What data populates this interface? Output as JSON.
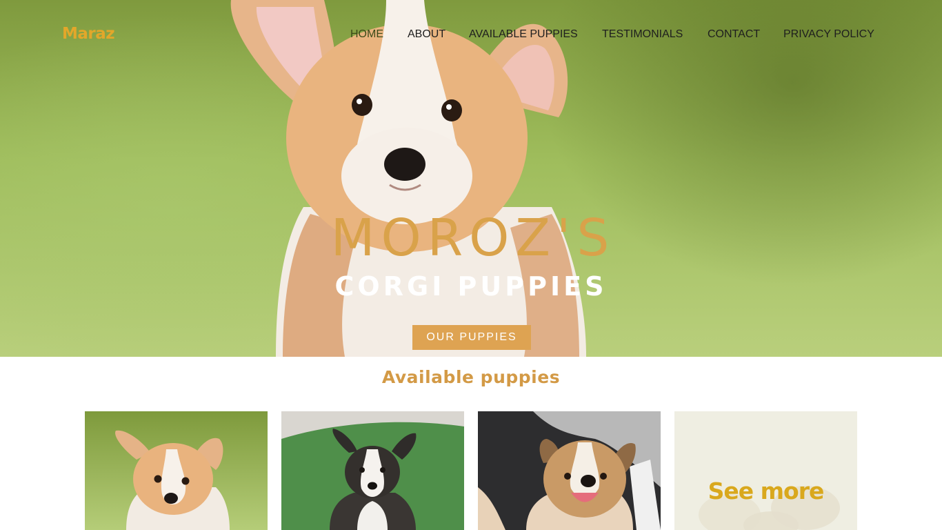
{
  "brand": {
    "logo_text": "Maraz"
  },
  "nav": {
    "items": [
      {
        "label": "HOME",
        "active": true
      },
      {
        "label": "ABOUT",
        "active": false
      },
      {
        "label": "AVAILABLE PUPPIES",
        "active": false
      },
      {
        "label": "TESTIMONIALS",
        "active": false
      },
      {
        "label": "CONTACT",
        "active": false
      },
      {
        "label": "PRIVACY POLICY",
        "active": false
      }
    ]
  },
  "hero": {
    "title": "MOROZ'S",
    "subtitle": "CORGI PUPPIES",
    "button_label": "OUR PUPPIES"
  },
  "available": {
    "heading": "Available puppies",
    "cards": [
      {
        "image": "corgi-puppy-on-grass"
      },
      {
        "image": "tricolor-corgi-puppy-on-turf"
      },
      {
        "image": "smiling-corgi-puppy-in-car"
      },
      {
        "image": "see-more-tile",
        "label": "See more"
      }
    ]
  },
  "colors": {
    "accent": "#dea352",
    "title_gold": "#d9a24a",
    "logo": "#e3a72a",
    "see_more": "#d9a81d",
    "nav_text": "#1e1e1e"
  }
}
